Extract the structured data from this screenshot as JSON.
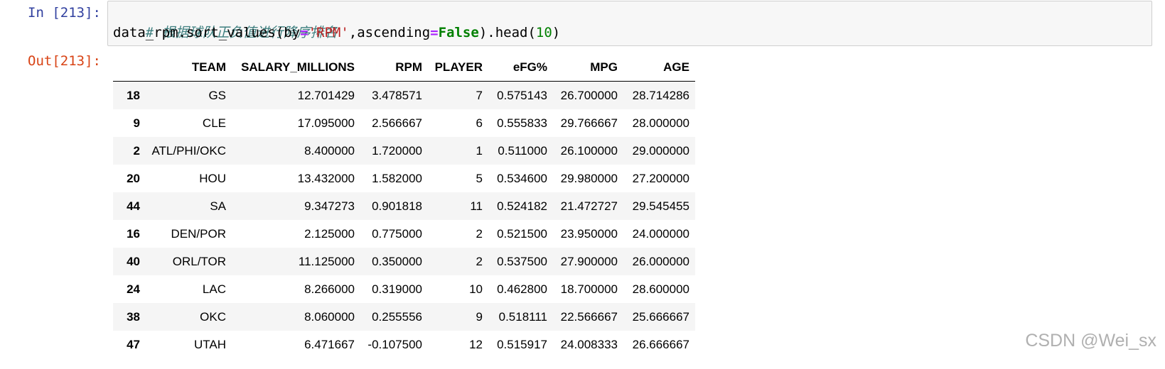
{
  "input_cell": {
    "prompt": "In [213]:",
    "comment": "# 根据球队正负值进行降序排名",
    "code": {
      "func": "data_rpm.sort_values(by",
      "eq1": "=",
      "arg_str": "'RPM'",
      "mid": ",ascending",
      "eq2": "=",
      "kw": "False",
      "tail1": ").head(",
      "num": "10",
      "tail2": ")"
    }
  },
  "output_cell": {
    "prompt": "Out[213]:",
    "table": {
      "columns": [
        "",
        "TEAM",
        "SALARY_MILLIONS",
        "RPM",
        "PLAYER",
        "eFG%",
        "MPG",
        "AGE"
      ],
      "rows": [
        [
          "18",
          "GS",
          "12.701429",
          "3.478571",
          "7",
          "0.575143",
          "26.700000",
          "28.714286"
        ],
        [
          "9",
          "CLE",
          "17.095000",
          "2.566667",
          "6",
          "0.555833",
          "29.766667",
          "28.000000"
        ],
        [
          "2",
          "ATL/PHI/OKC",
          "8.400000",
          "1.720000",
          "1",
          "0.511000",
          "26.100000",
          "29.000000"
        ],
        [
          "20",
          "HOU",
          "13.432000",
          "1.582000",
          "5",
          "0.534600",
          "29.980000",
          "27.200000"
        ],
        [
          "44",
          "SA",
          "9.347273",
          "0.901818",
          "11",
          "0.524182",
          "21.472727",
          "29.545455"
        ],
        [
          "16",
          "DEN/POR",
          "2.125000",
          "0.775000",
          "2",
          "0.521500",
          "23.950000",
          "24.000000"
        ],
        [
          "40",
          "ORL/TOR",
          "11.125000",
          "0.350000",
          "2",
          "0.537500",
          "27.900000",
          "26.000000"
        ],
        [
          "24",
          "LAC",
          "8.266000",
          "0.319000",
          "10",
          "0.462800",
          "18.700000",
          "28.600000"
        ],
        [
          "38",
          "OKC",
          "8.060000",
          "0.255556",
          "9",
          "0.518111",
          "22.566667",
          "25.666667"
        ],
        [
          "47",
          "UTAH",
          "6.471667",
          "-0.107500",
          "12",
          "0.515917",
          "24.008333",
          "26.666667"
        ]
      ]
    }
  },
  "watermark": "CSDN @Wei_sx",
  "colors": {
    "in_prompt": "#303f9f",
    "out_prompt": "#d84315",
    "code_bg": "#f7f7f7",
    "comment": "#408080",
    "string": "#ba2121",
    "keyword": "#008000",
    "operator": "#aa22ff"
  }
}
